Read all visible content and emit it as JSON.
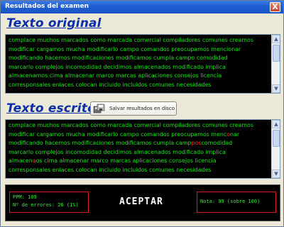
{
  "window": {
    "title": "Resultados del examen",
    "close_label": "X"
  },
  "original": {
    "heading": "Texto original",
    "lines": [
      "complace muchos marcados como marcada comercial compiladores comunes creamos",
      "modificar cargamos mucha modificarlo campo comandos preocupamos mencionar",
      "modificando hacemos modificaciones modificamos cumpla campo comodidad",
      "marcarlo complejos incomodidad decidimos almacenados modificado implica",
      "almacenamos cima almacenar marco marcas aplicaciones consejos licencia",
      "corresponsales enlaces colocan incluido incluidos comunes necesidades"
    ]
  },
  "written": {
    "heading": "Texto escrito",
    "lines": [
      [
        "complace muchos marcados como marcada comercial compiladores comunes creamos"
      ],
      [
        "modificar cargamos mucha modificarlo campo comandos preocupamos menc",
        "o",
        "nar"
      ],
      [
        "modificando hacemos modificaciones modificamos cumpla camp",
        "pos",
        "comodidad"
      ],
      [
        "marcarlo complejos incomodidad decidimos almacenados modificado implica"
      ],
      [
        "almacen",
        "a",
        "os cima almacenar marco marcas aplicaciones consejos licencia"
      ],
      [
        "corresponsales enlaces colocan incluido incluidos comunes necesidades"
      ]
    ]
  },
  "save_button": {
    "label": "Salvar resultados en disco",
    "icon": "save-disk-icon"
  },
  "results": {
    "ppm_label": "PPM: 109",
    "errors_label": "Nº de errores: 26 (1%)",
    "accept_label": "ACEPTAR",
    "grade_label": "Nota: 99 (sobre 100)"
  },
  "colors": {
    "text_green": "#19e619",
    "error_red": "#ff3030",
    "heading_blue": "#0b2fa8",
    "titlebar_blue": "#1d5fd3"
  }
}
